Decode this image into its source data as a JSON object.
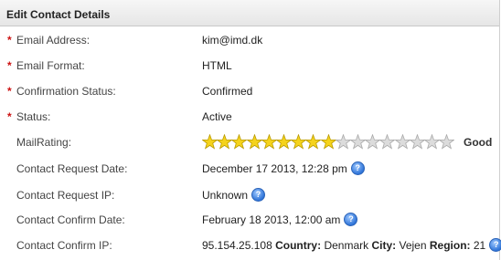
{
  "panel": {
    "title": "Edit Contact Details"
  },
  "fields": [
    {
      "label": "Email Address:",
      "required": true,
      "value": "kim@imd.dk"
    },
    {
      "label": "Email Format:",
      "required": true,
      "value": "HTML"
    },
    {
      "label": "Confirmation Status:",
      "required": true,
      "value": "Confirmed"
    },
    {
      "label": "Status:",
      "required": true,
      "value": "Active"
    }
  ],
  "mailrating": {
    "label": "MailRating:",
    "filled": 9,
    "total": 17,
    "word": "Good",
    "filled_color": "#f5d31c",
    "empty_color": "#dcdcdc"
  },
  "contact_request_date": {
    "label": "Contact Request Date:",
    "value": "December 17 2013, 12:28 pm"
  },
  "contact_request_ip": {
    "label": "Contact Request IP:",
    "value": "Unknown"
  },
  "contact_confirm_date": {
    "label": "Contact Confirm Date:",
    "value": "February 18 2013, 12:00 am"
  },
  "contact_confirm_ip": {
    "label": "Contact Confirm IP:",
    "ip": "95.154.25.108",
    "country_label": "Country:",
    "country": "Denmark",
    "city_label": "City:",
    "city": "Vejen",
    "region_label": "Region:",
    "region": "21"
  },
  "required_marker": "*",
  "help_icon_glyph": "?"
}
